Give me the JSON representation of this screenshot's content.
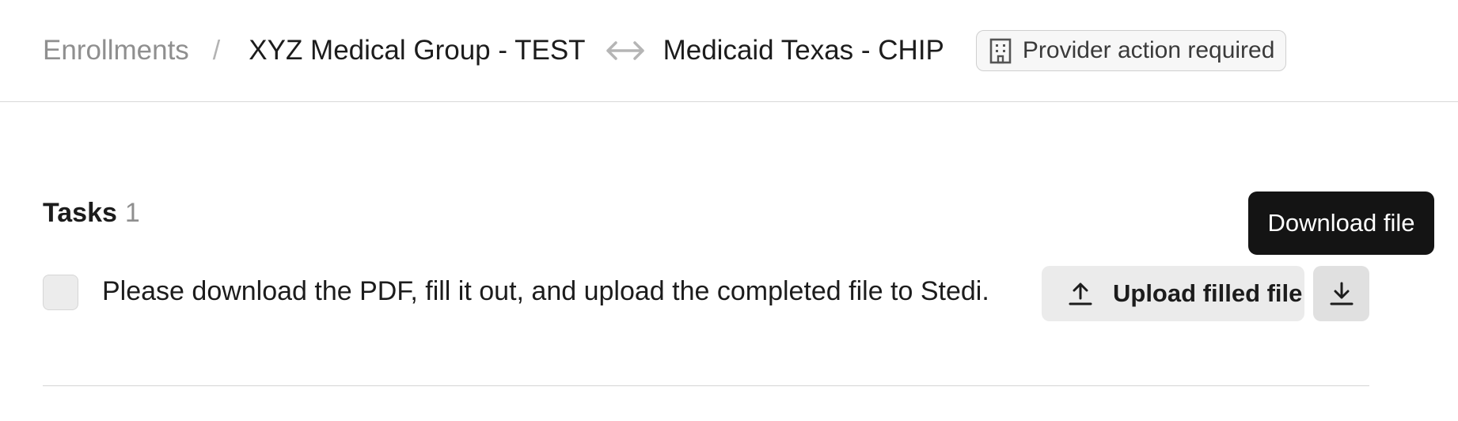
{
  "breadcrumb": {
    "root": "Enrollments",
    "separator": "/",
    "provider": "XYZ Medical Group - TEST",
    "swap_icon": "arrows-left-right-icon",
    "payer": "Medicaid Texas - CHIP"
  },
  "status_badge": {
    "icon": "building-icon",
    "label": "Provider action required"
  },
  "tasks": {
    "title": "Tasks",
    "count": "1",
    "items": [
      {
        "text": "Please download the PDF, fill it out, and upload the completed file to Stedi.",
        "checked": false,
        "upload_label": "Upload filled file",
        "upload_icon": "upload-icon",
        "download_icon": "download-icon"
      }
    ]
  },
  "tooltip": {
    "text": "Download file"
  },
  "colors": {
    "muted_text": "#8f8f8f",
    "tooltip_bg": "#141414",
    "button_bg": "#ebebeb"
  }
}
